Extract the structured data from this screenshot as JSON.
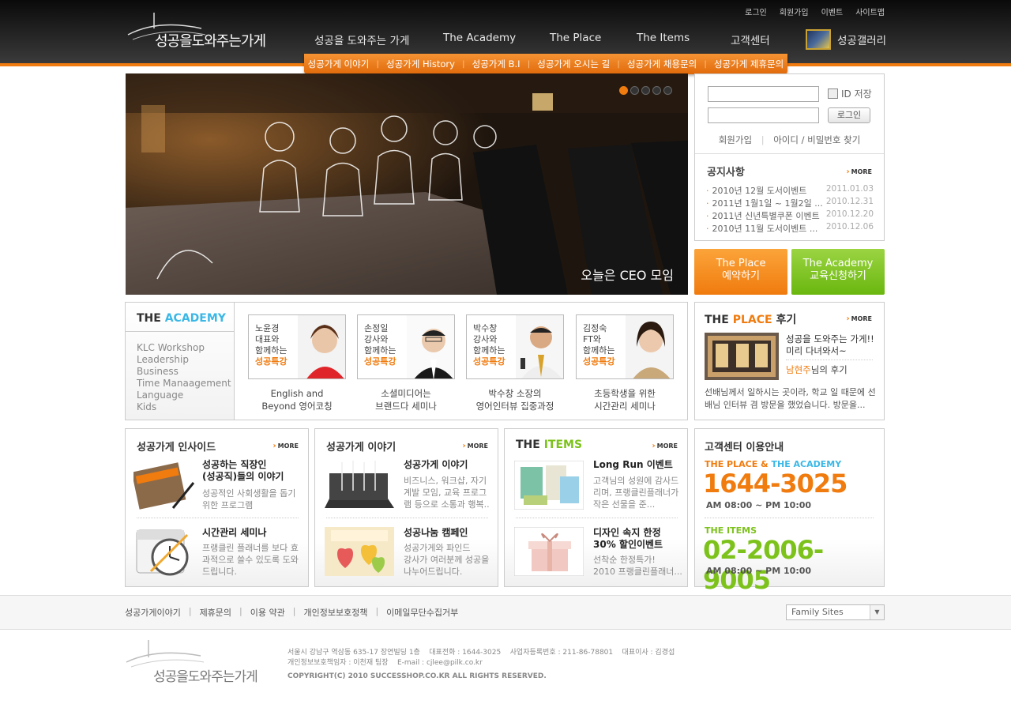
{
  "header": {
    "logo_text": "성공을도와주는가게",
    "top_links": [
      "로그인",
      "회원가입",
      "이벤트",
      "사이트맵"
    ],
    "gnb": [
      "성공을 도와주는 가게",
      "The Academy",
      "The Place",
      "The  Items",
      "고객센터",
      "성공갤러리"
    ],
    "subnav": [
      "성공가게 이야기",
      "성공가게 History",
      "성공가게 B.I",
      "성공가게 오시는 길",
      "성공가게 채용문의",
      "성공가게 제휴문의"
    ]
  },
  "hero": {
    "caption": "오늘은 CEO 모임",
    "dots": 5,
    "active_dot": 0
  },
  "login": {
    "id_save": "ID 저장",
    "button": "로그인",
    "join": "회원가입",
    "find": "아이디 / 비밀번호 찾기"
  },
  "notice": {
    "title": "공지사항",
    "more": "MORE",
    "items": [
      {
        "text": "2010년 12월 도서이벤트",
        "date": "2011.01.03"
      },
      {
        "text": "2011년 1월1일 ~ 1월2일 ...",
        "date": "2010.12.31"
      },
      {
        "text": "2011년 신년특별쿠폰 이벤트",
        "date": "2010.12.20"
      },
      {
        "text": "2010년 11월 도서이벤트 ...",
        "date": "2010.12.06"
      }
    ]
  },
  "quick": {
    "place": {
      "l1": "The Place",
      "l2": "예약하기"
    },
    "academy": {
      "l1": "The Academy",
      "l2": "교육신청하기"
    }
  },
  "academy": {
    "title_a": "THE ",
    "title_b": "ACADEMY",
    "menu": [
      "KLC Workshop",
      "Leadership",
      "Business",
      "Time Manaagement",
      "Language",
      "Kids"
    ],
    "speakers": [
      {
        "l1": "노윤경",
        "l2": "대표와",
        "l3": "함께하는",
        "tag": "성공특강",
        "cap1": "English and",
        "cap2": "Beyond 영어코칭"
      },
      {
        "l1": "손정일",
        "l2": "강사와",
        "l3": "함께하는",
        "tag": "성공특강",
        "cap1": "소셜미디어는",
        "cap2": "브랜드다 세미나"
      },
      {
        "l1": "박수창",
        "l2": "강사와",
        "l3": "함께하는",
        "tag": "성공특강",
        "cap1": "박수창 소장의",
        "cap2": "영어인터뷰 집중과정"
      },
      {
        "l1": "김정숙",
        "l2": "FT와",
        "l3": "함께하는",
        "tag": "성공특강",
        "cap1": "초등학생을 위한",
        "cap2": "시간관리 세미나"
      }
    ]
  },
  "review": {
    "title_a": "THE ",
    "title_b": "PLACE",
    "title_c": " 후기",
    "more": "MORE",
    "head1": "성공을 도와주는 가게!!",
    "head2": "미리 다녀와서~",
    "author": "남현주",
    "author_suffix": "님의 후기",
    "body1": "선배님께서 일하시는 곳이라, 학교 일 때문에 선",
    "body2": "배님 인터뷰 겸 방문을 했었습니다. 방문을..."
  },
  "inside": {
    "title": "성공가게 인사이드",
    "more": "MORE",
    "items": [
      {
        "t1": "성공하는 직장인",
        "t2": "(성공직)들의 이야기",
        "d1": "성공적인 사회생활을 돕기",
        "d2": "위한 프로그램",
        "d3": ""
      },
      {
        "t1": "시간관리 세미나",
        "t2": "",
        "d1": "프랭클린 플래너를 보다 효",
        "d2": "과적으로 쓸수 있도록 도와",
        "d3": "드립니다."
      }
    ]
  },
  "story": {
    "title": "성공가게 이야기",
    "more": "MORE",
    "items": [
      {
        "t1": "성공가게 이야기",
        "d1": "비즈니스, 워크샵, 자기",
        "d2": "계발 모임, 교육 프로그",
        "d3": "램 등으로 소통과 행복.."
      },
      {
        "t1": "성공나눔 캠페인",
        "d1": "성공가게와 파인드",
        "d2": "강사가 여러분께 성공을",
        "d3": "나누어드립니다."
      }
    ]
  },
  "items": {
    "title_a": "THE ",
    "title_b": "ITEMS",
    "more": "MORE",
    "items": [
      {
        "t1": "Long Run 이벤트",
        "t2": "",
        "d1": "고객님의 성원에 감사드",
        "d2": "리며, 프랭클린플래너가",
        "d3": "작은 선물을 준..."
      },
      {
        "t1": "디자인 속지 한정",
        "t2": "30% 할인이벤트",
        "d1": "선착순 한정특가!",
        "d2": "2010 프랭클린플래너...",
        "d3": ""
      }
    ]
  },
  "cs": {
    "title": "고객센터 이용안내",
    "label1_a": "THE PLACE & ",
    "label1_b": "THE ACADEMY",
    "phone1": "1644-3025",
    "hours1": "AM 08:00 ~ PM 10:00",
    "label2": "THE ITEMS",
    "phone2": "02-2006-9005",
    "hours2": "AM 08:00 ~ PM 10:00"
  },
  "footer": {
    "links": [
      "성공가게이야기",
      "제휴문의",
      "이용 약관",
      "개인정보보호정책",
      "이메일무단수집거부"
    ],
    "family": "Family Sites",
    "logo_text": "성공을도와주는가게",
    "info1": "서울시 강남구 역삼동 635-17 장연빌딩 1층    대표전화 : 1644-3025    사업자등록번호 : 211-86-78801    대표이사 : 김경섭",
    "info2": "개인정보보호책임자 : 이천재 팀장    E-mail : cjlee@pilk.co.kr",
    "info3": "COPYRIGHT(C) 2010 SUCCESSHOP.CO.KR ALL RIGHTS RESERVED."
  },
  "colors": {
    "accent": "#f07b0e",
    "academy_blue": "#3bb7e6",
    "green": "#7cc21b"
  }
}
